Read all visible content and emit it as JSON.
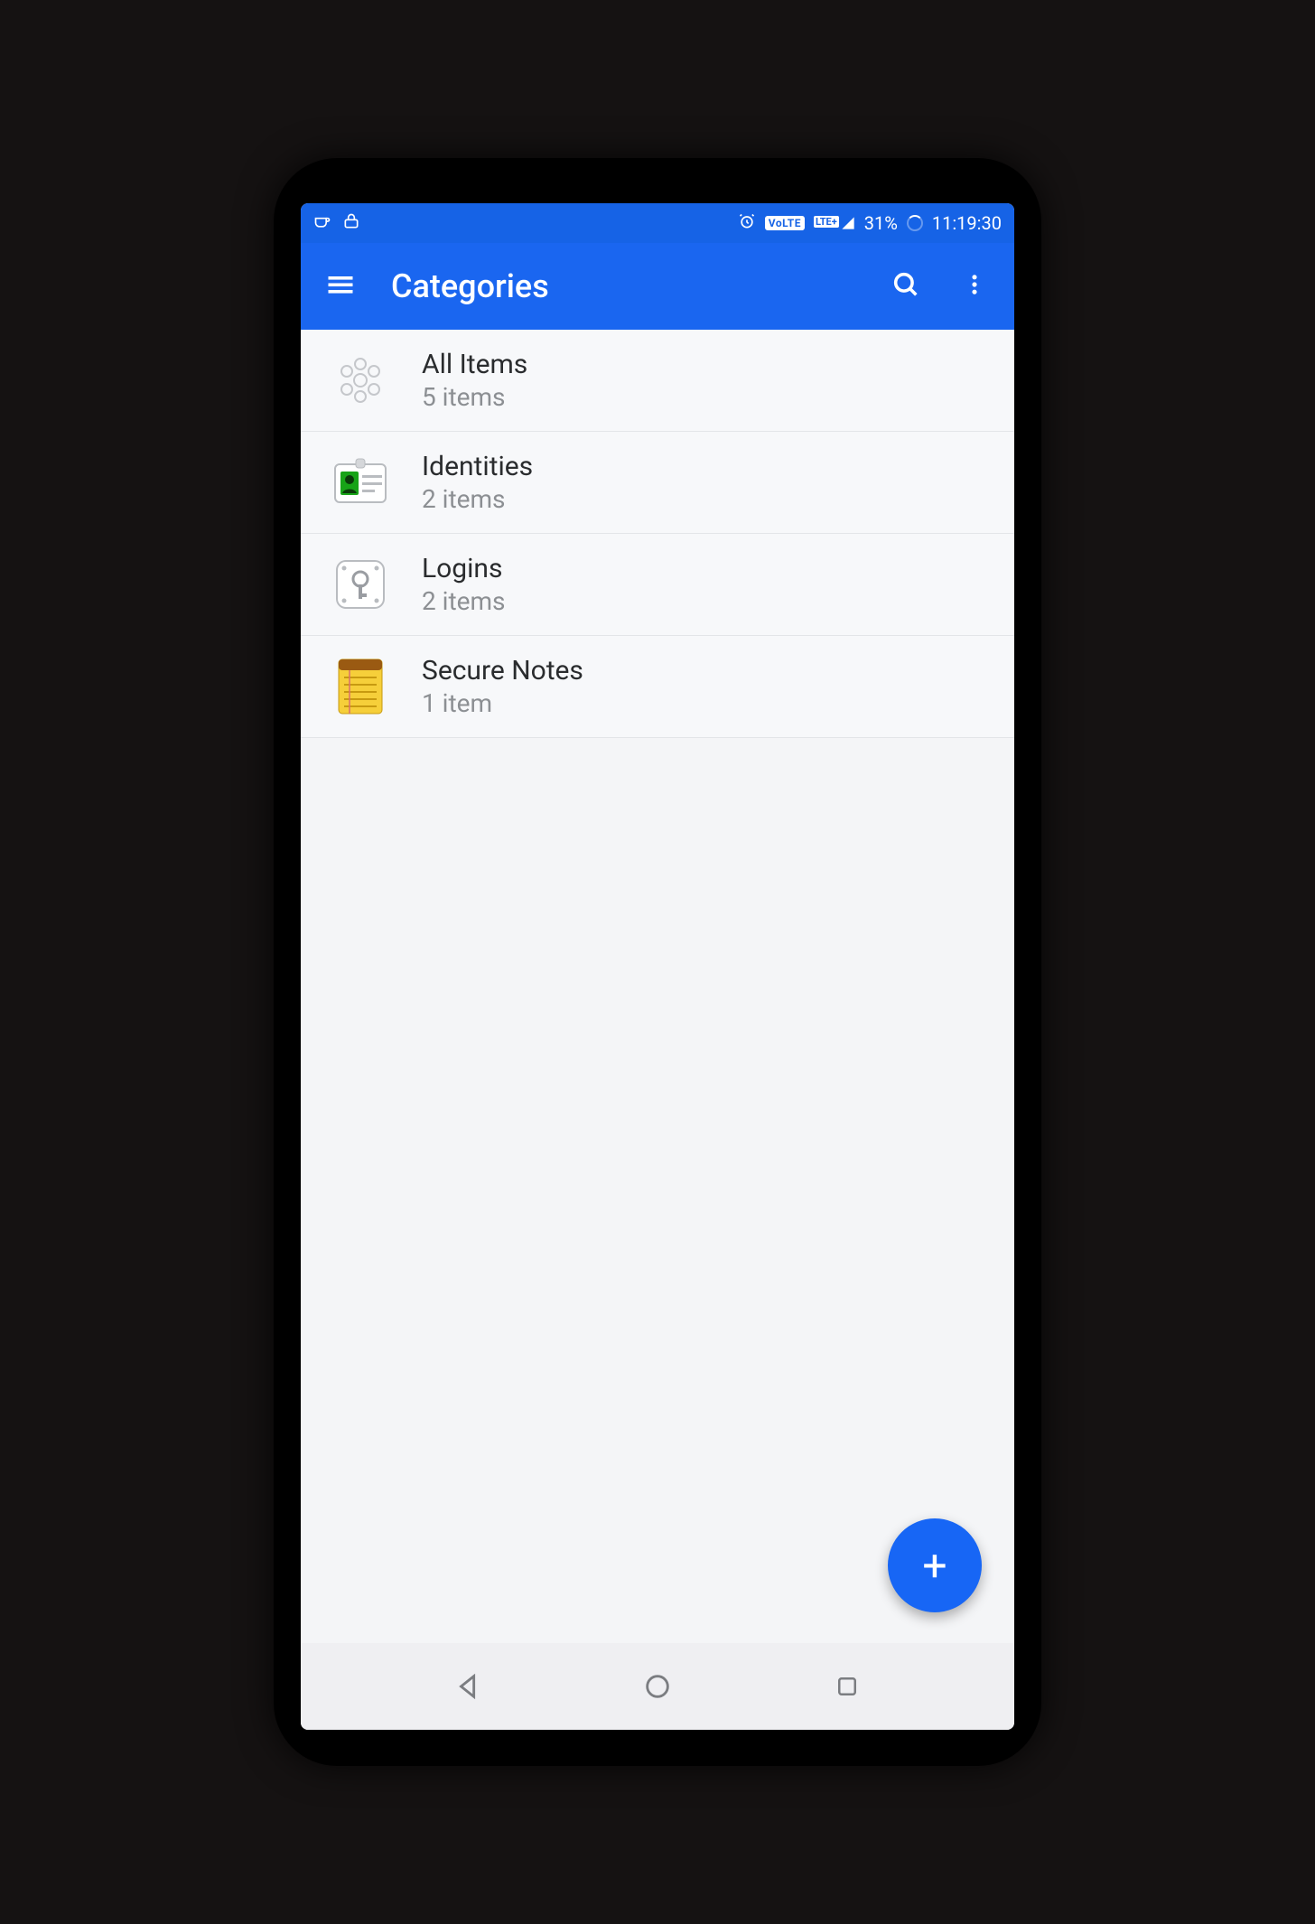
{
  "status": {
    "volte_label": "VoLTE",
    "signal_label": "LTE+",
    "battery_text": "31%",
    "time_text": "11:19:30"
  },
  "appbar": {
    "title": "Categories"
  },
  "categories": [
    {
      "title": "All Items",
      "subtitle": "5 items",
      "icon": "all"
    },
    {
      "title": "Identities",
      "subtitle": "2 items",
      "icon": "identity"
    },
    {
      "title": "Logins",
      "subtitle": "2 items",
      "icon": "login"
    },
    {
      "title": "Secure Notes",
      "subtitle": "1 item",
      "icon": "note"
    }
  ],
  "fab": {
    "label": "+"
  }
}
